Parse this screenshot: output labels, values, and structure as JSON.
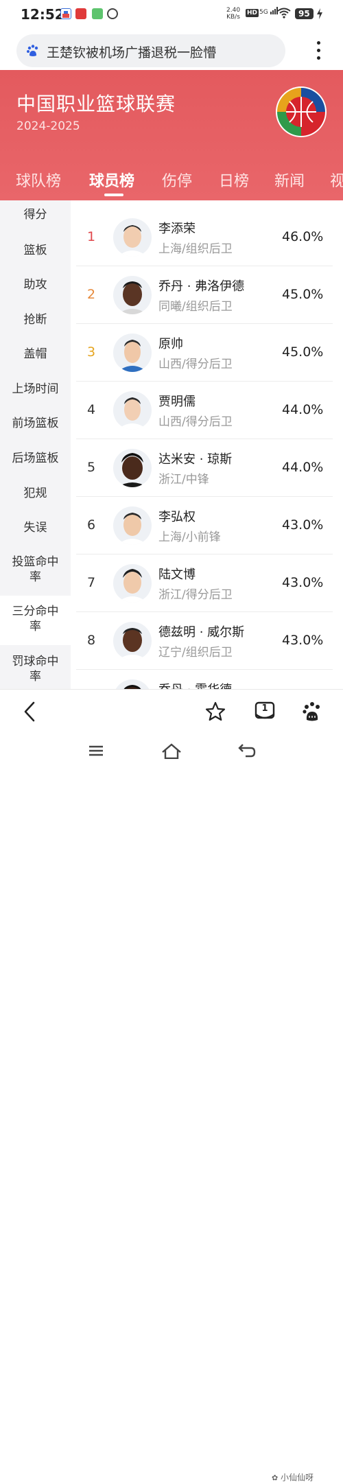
{
  "status_bar": {
    "time": "12:52",
    "net_speed": "2.40",
    "net_unit": "KB/s",
    "hd": "HD",
    "signal": "5G",
    "battery": "95"
  },
  "search": {
    "query": "王楚钦被机场广播退税一脸懵"
  },
  "header": {
    "title": "中国职业篮球联赛",
    "season": "2024-2025",
    "tabs": [
      {
        "label": "球队榜"
      },
      {
        "label": "球员榜"
      },
      {
        "label": "伤停"
      },
      {
        "label": "日榜"
      },
      {
        "label": "新闻"
      },
      {
        "label": "视"
      }
    ],
    "active_tab": 1
  },
  "sidebar": {
    "items": [
      {
        "label": "得分"
      },
      {
        "label": "篮板"
      },
      {
        "label": "助攻"
      },
      {
        "label": "抢断"
      },
      {
        "label": "盖帽"
      },
      {
        "label": "上场时间"
      },
      {
        "label": "前场篮板"
      },
      {
        "label": "后场篮板"
      },
      {
        "label": "犯规"
      },
      {
        "label": "失误"
      },
      {
        "label": "投篮命中率"
      },
      {
        "label": "三分命中率"
      },
      {
        "label": "罚球命中率"
      }
    ],
    "active_item": 11
  },
  "players": [
    {
      "rank": "1",
      "name": "李添荣",
      "team": "上海/组织后卫",
      "value": "46.0%"
    },
    {
      "rank": "2",
      "name": "乔丹 · 弗洛伊德",
      "team": "同曦/组织后卫",
      "value": "45.0%"
    },
    {
      "rank": "3",
      "name": "原帅",
      "team": "山西/得分后卫",
      "value": "45.0%"
    },
    {
      "rank": "4",
      "name": "贾明儒",
      "team": "山西/得分后卫",
      "value": "44.0%"
    },
    {
      "rank": "5",
      "name": "达米安 · 琼斯",
      "team": "浙江/中锋",
      "value": "44.0%"
    },
    {
      "rank": "6",
      "name": "李弘权",
      "team": "上海/小前锋",
      "value": "43.0%"
    },
    {
      "rank": "7",
      "name": "陆文博",
      "team": "浙江/得分后卫",
      "value": "43.0%"
    },
    {
      "rank": "8",
      "name": "德兹明 · 威尔斯",
      "team": "辽宁/组织后卫",
      "value": "43.0%"
    },
    {
      "rank": "",
      "name": "乔丹 · 霍华德",
      "team": "",
      "value": ""
    }
  ],
  "colors": {
    "header": "#e35a5e",
    "rank1": "#e0454a",
    "rank2": "#e6893a",
    "rank3": "#e6a520",
    "sidebar_bg": "#f4f4f6"
  },
  "bottom_bar": {
    "tab_count": "1"
  },
  "watermark": "小仙仙呀"
}
